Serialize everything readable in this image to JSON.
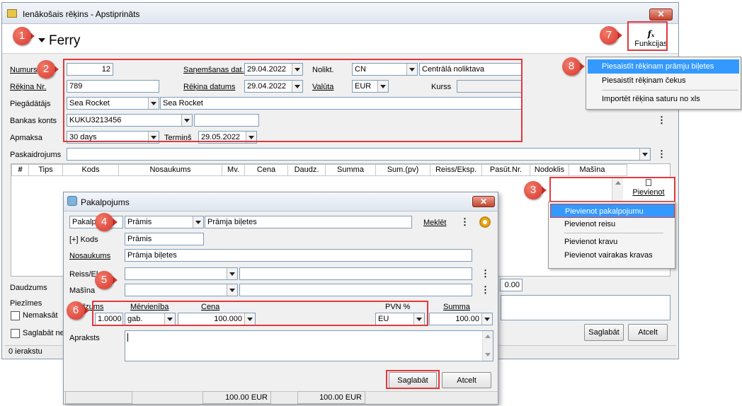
{
  "main_window": {
    "title": "Ienākošais rēķins - Apstiprināts",
    "header_title": "Ferry",
    "functions_button": "Funkcijas",
    "fields": {
      "numurs_label": "Numurs",
      "numurs_value": "12",
      "sanemsanas_label": "Saņemšanas dat.",
      "sanemsanas_value": "29.04.2022",
      "nolikt_label": "Nolikt.",
      "nolikt_code": "CN",
      "nolikt_name": "Centrālā noliktava",
      "rekina_nr_label": "Rēķina Nr.",
      "rekina_nr_value": "789",
      "rekina_datums_label": "Rēķina datums",
      "rekina_datums_value": "29.04.2022",
      "valuta_label": "Valūta",
      "valuta_value": "EUR",
      "kurss_label": "Kurss",
      "kurss_value": "",
      "piegadatajs_label": "Piegādātājs",
      "piegadatajs_code": "Sea Rocket",
      "piegadatajs_name": "Sea Rocket",
      "bankas_konts_label": "Bankas konts",
      "bankas_konts_value": "KUKU3213456",
      "apmaksa_label": "Apmaksa",
      "apmaksa_value": "30 days",
      "termins_label": "Termiņš",
      "termins_value": "29.05.2022",
      "paskaidrojums_label": "Paskaidrojums",
      "paskaidrojums_value": ""
    },
    "grid_columns": [
      "#",
      "Tips",
      "Kods",
      "Nosaukums",
      "Mv.",
      "Cena",
      "Daudz.",
      "Summa",
      "Sum.(pv)",
      "Reiss/Eksp.",
      "Pasūt.Nr.",
      "Nodoklis",
      "Mašīna"
    ],
    "daudzums_label": "Daudzums",
    "daudzums_total": "0.00",
    "piezimes_label": "Piezīmes",
    "nemaksat_label": "Nemaksāt",
    "saglabat_ne_label": "Saglabāt ne",
    "save_button": "Saglabāt",
    "cancel_button": "Atcelt",
    "status_text": "0 ierakstu",
    "add_button": "Pievienot"
  },
  "functions_menu": {
    "items": [
      "Piesaistīt rēķinam prāmju biļetes",
      "Piesaistīt rēķinam čekus",
      "Importēt rēķina saturu no xls"
    ],
    "selected": "Piesaistīt rēķinam prāmju biļetes"
  },
  "add_menu": {
    "items": [
      "Pievienot pakalpojumu",
      "Pievienot reisu",
      "Pievienot kravu",
      "Pievienot vairakas kravas"
    ],
    "selected": "Pievienot pakalpojumu"
  },
  "dialog": {
    "title": "Pakalpojums",
    "pakalpojums_label": "Pakalp",
    "pakalpojums_code": "Prāmis",
    "pakalpojums_name": "Prāmja biļetes",
    "search_label": "Meklēt",
    "kods_label": "[+] Kods",
    "kods_value": "Prāmis",
    "nosaukums_label": "Nosaukums",
    "nosaukums_value": "Prāmja biļetes",
    "reiss_label": "Reiss/Ek",
    "reiss_value": "",
    "masina_label": "Mašīna",
    "masina_value": "",
    "daudzums_label": "dzums",
    "daudzums_value": "1.0000",
    "mervieniba_label": "Mērvienība",
    "mervieniba_value": "gab.",
    "cena_label": "Cena",
    "cena_value": "100.000",
    "pvn_label": "PVN %",
    "pvn_value": "EU",
    "summa_label": "Summa",
    "summa_value": "100.00",
    "apraksts_label": "Apraksts",
    "apraksts_value": "",
    "save_button": "Saglabāt",
    "cancel_button": "Atcelt",
    "status_amount_1": "100.00 EUR",
    "status_amount_2": "100.00 EUR"
  },
  "annotations": [
    "1",
    "2",
    "3",
    "4",
    "5",
    "6",
    "7",
    "8"
  ],
  "colors": {
    "highlight_red": "#e0393e",
    "selection_blue": "#3399ff",
    "badge_red": "#d9362c"
  }
}
